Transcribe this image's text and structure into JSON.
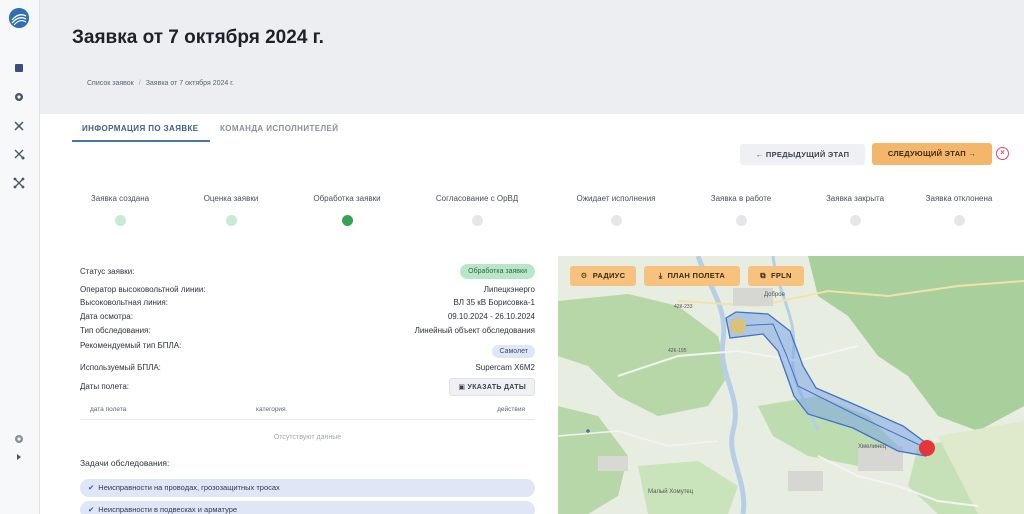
{
  "sidebar": {
    "icons": [
      "logo-icon",
      "grid-icon",
      "settings-icon",
      "drone-icon",
      "route-icon",
      "network-icon",
      "settings-icon",
      "expand-icon"
    ]
  },
  "header": {
    "title": "Заявка от 7 октября 2024 г.",
    "breadcrumb": [
      "Список заявок",
      "Заявка от 7 октября 2024 г."
    ]
  },
  "tabs": [
    {
      "label": "ИНФОРМАЦИЯ ПО ЗАЯВКЕ",
      "active": true
    },
    {
      "label": "КОМАНДА ИСПОЛНИТЕЛЕЙ",
      "active": false
    }
  ],
  "actions": {
    "prev_label": "← ПРЕДЫДУЩИЙ ЭТАП",
    "next_label": "СЛЕДУЮЩИЙ ЭТАП →"
  },
  "steps": [
    {
      "label": "Заявка создана",
      "state": "done"
    },
    {
      "label": "Оценка заявки",
      "state": "done"
    },
    {
      "label": "Обработка заявки",
      "state": "current"
    },
    {
      "label": "Согласование с ОрВД",
      "state": "pending"
    },
    {
      "label": "Ожидает исполнения",
      "state": "pending"
    },
    {
      "label": "Заявка в работе",
      "state": "pending"
    },
    {
      "label": "Заявка закрыта",
      "state": "pending"
    },
    {
      "label": "Заявка отклонена",
      "state": "pending"
    }
  ],
  "details": {
    "status_label": "Статус заявки:",
    "status_value": "Обработка заявки",
    "operator_label": "Оператор высоковольтной линии:",
    "operator_value": "Липецкэнерго",
    "line_label": "Высоковольтная линия:",
    "line_value": "ВЛ 35 кВ Борисовка-1",
    "date_label": "Дата осмотра:",
    "date_value": "09.10.2024 - 26.10.2024",
    "survey_type_label": "Тип обследования:",
    "survey_type_value": "Линейный объект обследования",
    "uav_type_label": "Рекомендуемый тип БПЛА:",
    "uav_type_value": "Самолет",
    "used_uav_label": "Используемый БПЛА:",
    "used_uav_value": "Supercam X6M2",
    "flight_dates_label": "Даты полета:",
    "set_dates_button": "УКАЗАТЬ ДАТЫ",
    "table_headers": [
      "дата полета",
      "категория",
      "действия"
    ],
    "table_empty": "Отсутствуют данные",
    "tasks_label": "Задачи обследования:",
    "tasks": [
      "Неисправности на проводах, грозозащитных тросах",
      "Неисправности в подвесках и арматуре"
    ]
  },
  "map": {
    "buttons": [
      {
        "icon": "gear-icon",
        "glyph": "⚙",
        "label": "РАДИУС"
      },
      {
        "icon": "download-icon",
        "glyph": "⤓",
        "label": "ПЛАН ПОЛЕТА"
      },
      {
        "icon": "external-link-icon",
        "glyph": "⧉",
        "label": "FPLN"
      }
    ],
    "labels": [
      "Доброе",
      "42К-233",
      "42К-195",
      "Малый Хомутец",
      "Хмелинец"
    ]
  },
  "colors": {
    "accent": "#4a74a8",
    "next_button": "#f4b66a",
    "status_done": "#c9ead2",
    "status_current": "#35a353",
    "route_fill": "#7ea6e6",
    "start_point": "#d9c27a",
    "end_point": "#e8343a"
  }
}
